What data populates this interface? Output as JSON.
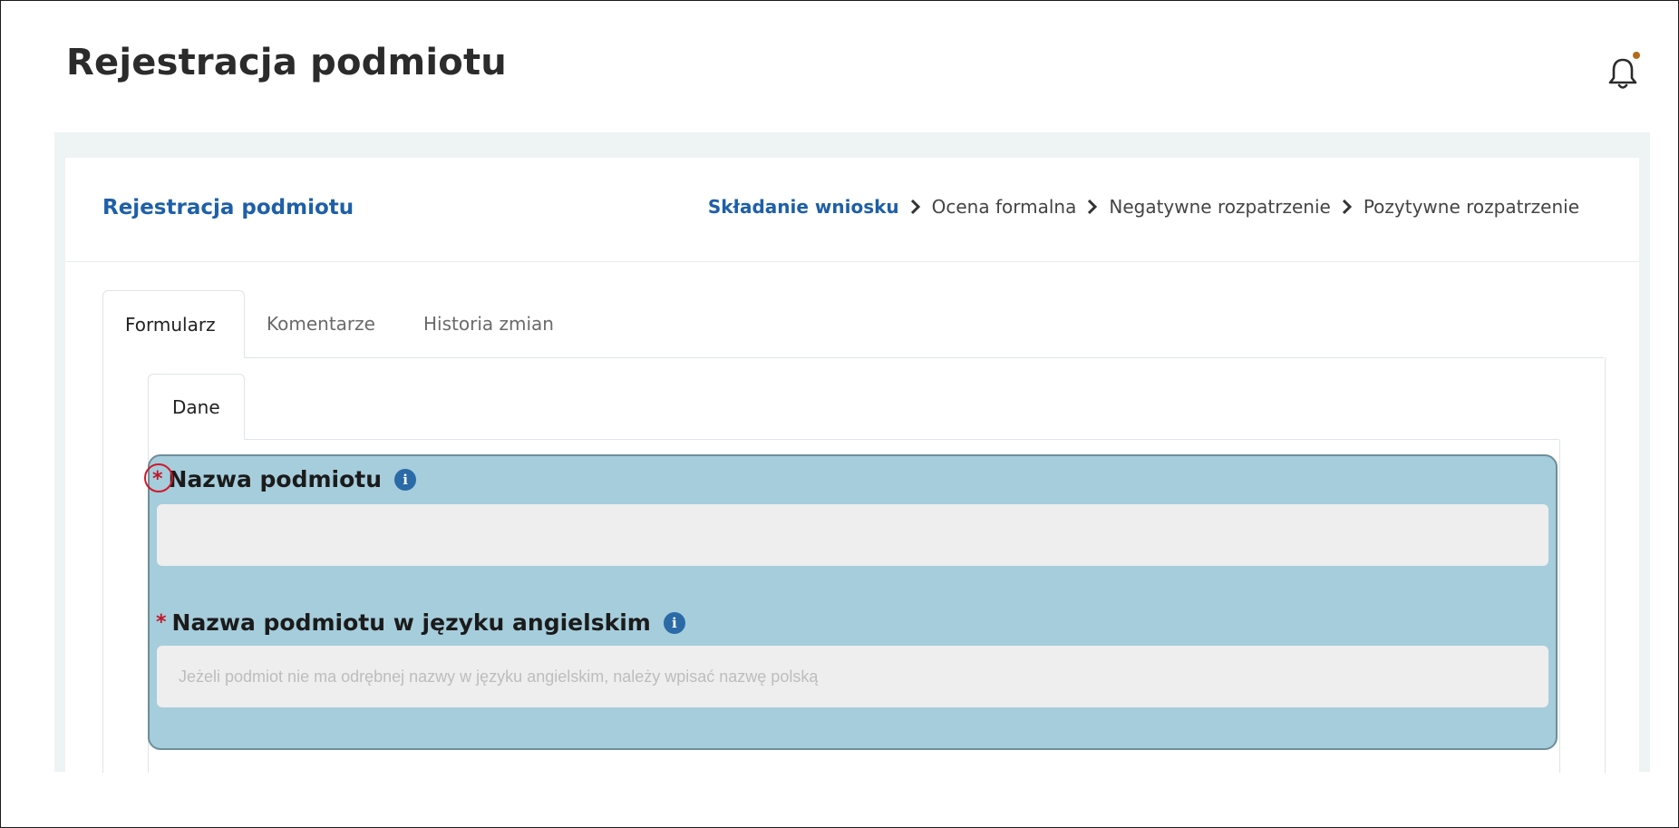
{
  "page": {
    "title": "Rejestracja podmiotu"
  },
  "header": {
    "notification_icon": "bell-icon",
    "notification_dot_color": "#b36a1d"
  },
  "card": {
    "title": "Rejestracja podmiotu",
    "steps": [
      {
        "label": "Składanie wniosku",
        "active": true
      },
      {
        "label": "Ocena formalna",
        "active": false
      },
      {
        "label": "Negatywne rozpatrzenie",
        "active": false
      },
      {
        "label": "Pozytywne rozpatrzenie",
        "active": false
      }
    ]
  },
  "tabs": [
    {
      "label": "Formularz",
      "active": true
    },
    {
      "label": "Komentarze",
      "active": false
    },
    {
      "label": "Historia zmian",
      "active": false
    }
  ],
  "subtabs": [
    {
      "label": "Dane",
      "active": true
    }
  ],
  "form": {
    "fields": [
      {
        "required_marker": "*",
        "label": "Nazwa podmiotu",
        "info_icon": "info-icon",
        "value": "",
        "placeholder": ""
      },
      {
        "required_marker": "*",
        "label": "Nazwa podmiotu w języku angielskim",
        "info_icon": "info-icon",
        "value": "",
        "placeholder": "Jeżeli podmiot nie ma odrębnej nazwy w języku angielskim, należy wpisać nazwę polską"
      }
    ]
  },
  "colors": {
    "accent": "#1e5fa8",
    "required": "#c0182a",
    "highlight_bg": "#a6cddc",
    "annotation_circle": "#d1182b"
  }
}
